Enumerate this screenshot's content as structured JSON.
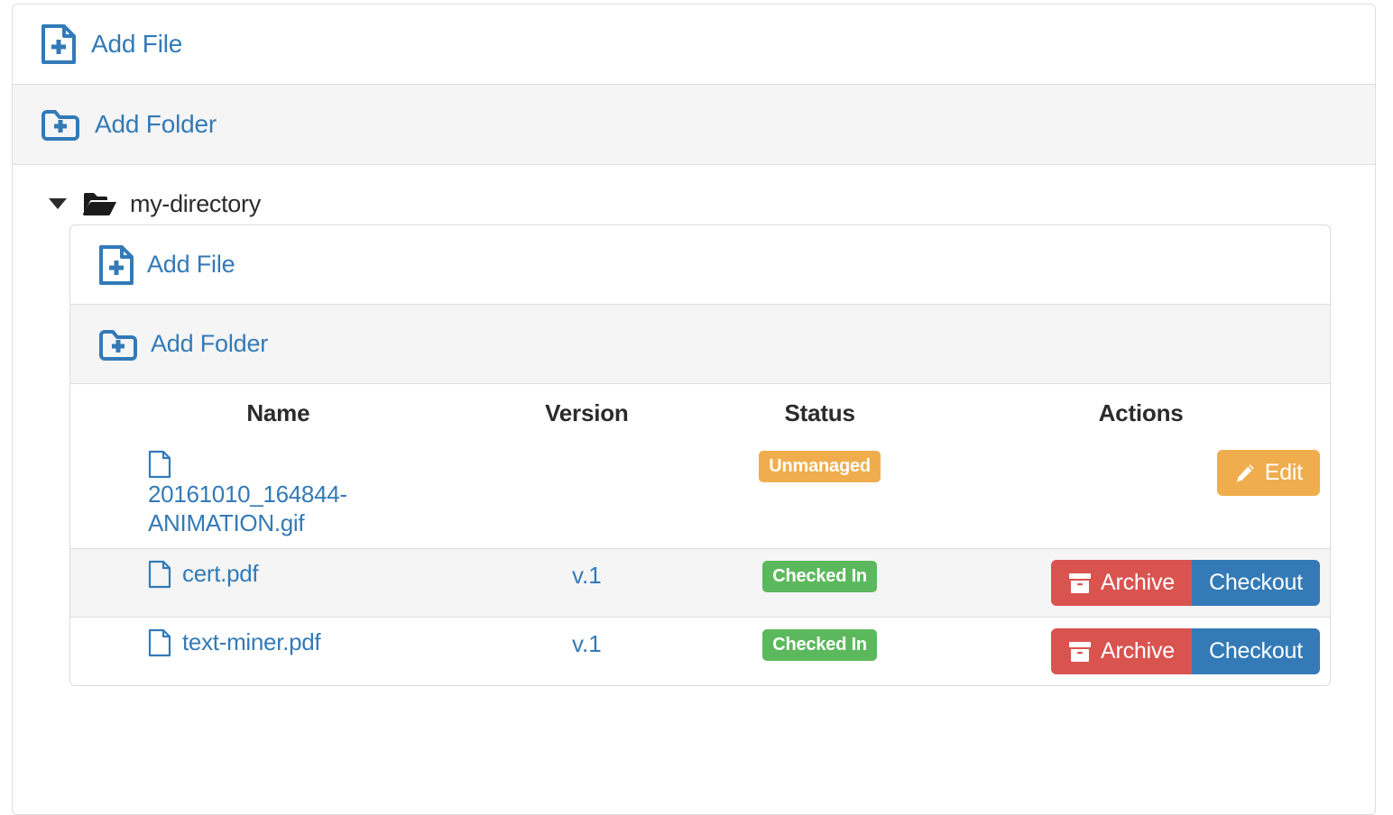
{
  "root": {
    "add_file_label": "Add File",
    "add_folder_label": "Add Folder",
    "add_file_icon": "file-plus-icon",
    "add_folder_icon": "folder-plus-icon"
  },
  "directory": {
    "name": "my-directory",
    "caret_icon": "caret-down-icon",
    "folder_icon": "folder-open-icon",
    "expanded": true,
    "add_file_label": "Add File",
    "add_folder_label": "Add Folder"
  },
  "table": {
    "headers": {
      "name": "Name",
      "version": "Version",
      "status": "Status",
      "actions": "Actions"
    },
    "rows": [
      {
        "name": "20161010_164844-ANIMATION.gif",
        "version": "",
        "status": "Unmanaged",
        "status_type": "warning",
        "file_icon": "file-document-icon",
        "wrapped": true,
        "actions": [
          {
            "label": "Edit",
            "type": "warning",
            "icon": "pencil-icon"
          }
        ]
      },
      {
        "name": "cert.pdf",
        "version": "v.1",
        "status": "Checked In",
        "status_type": "success",
        "file_icon": "file-document-icon",
        "wrapped": false,
        "actions": [
          {
            "label": "Archive",
            "type": "danger",
            "icon": "archive-box-icon"
          },
          {
            "label": "Checkout",
            "type": "primary",
            "icon": ""
          }
        ]
      },
      {
        "name": "text-miner.pdf",
        "version": "v.1",
        "status": "Checked In",
        "status_type": "success",
        "file_icon": "file-document-icon",
        "wrapped": false,
        "actions": [
          {
            "label": "Archive",
            "type": "danger",
            "icon": "archive-box-icon"
          },
          {
            "label": "Checkout",
            "type": "primary",
            "icon": ""
          }
        ]
      }
    ]
  },
  "colors": {
    "link": "#337ab7",
    "warning": "#f0ad4e",
    "success": "#5cb85c",
    "danger": "#d9534f",
    "primary": "#337ab7",
    "border": "#dddddd",
    "stripe": "#f5f5f5",
    "text": "#2b2b2b"
  }
}
